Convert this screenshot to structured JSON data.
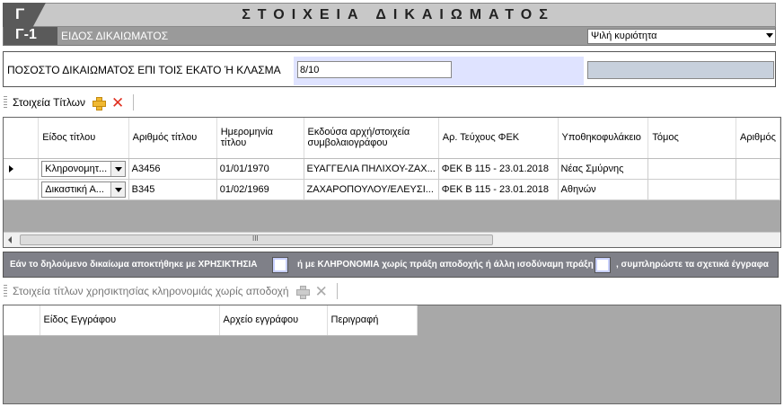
{
  "header": {
    "badge": "Γ",
    "title": "ΣΤΟΙΧΕΙΑ ΔΙΚΑΙΩΜΑΤΟΣ",
    "sub_badge": "Γ-1",
    "sub_label": "ΕΙΔΟΣ ΔΙΚΑΙΩΜΑΤΟΣ",
    "right_type_selected": "Ψιλή κυριότητα"
  },
  "percentage": {
    "label": "ΠΟΣΟΣΤΟ ΔΙΚΑΙΩΜΑΤΟΣ ΕΠΙ ΤΟΙΣ ΕΚΑΤΟ Ή ΚΛΑΣΜΑ",
    "value": "8/10"
  },
  "titles_toolbar": {
    "label": "Στοιχεία Τίτλων"
  },
  "titles_grid": {
    "columns": [
      "Είδος τίτλου",
      "Αριθμός τίτλου",
      "Ημερομηνία τίτλου",
      "Εκδούσα αρχή/στοιχεία συμβολαιογράφου",
      "Αρ. Τεύχους ΦΕΚ",
      "Υποθηκοφυλάκειο",
      "Τόμος",
      "Αριθμός"
    ],
    "rows": [
      {
        "type": "Κληρονομητ...",
        "number": "Α3456",
        "date": "01/01/1970",
        "authority": "ΕΥΑΓΓΕΛΙΑ ΠΗΛΙΧΟΥ-ΖΑΧ...",
        "fek": "ΦΕΚ Β 115 - 23.01.2018",
        "registry": "Νέας Σμύρνης",
        "volume": "",
        "num": ""
      },
      {
        "type": "Δικαστική Α...",
        "number": "Β345",
        "date": "01/02/1969",
        "authority": "ΖΑΧΑΡΟΠΟΥΛΟΥ/ΕΛΕΥΣΙ...",
        "fek": "ΦΕΚ Β 115 - 23.01.2018",
        "registry": "Αθηνών",
        "volume": "",
        "num": ""
      }
    ],
    "scroll_grip": "III"
  },
  "info_bar": {
    "part1": "Εάν το δηλούμενο δικαίωμα  αποκτήθηκε με ΧΡΗΣΙΚΤΗΣΙΑ",
    "part2": "ή με ΚΛΗΡΟΝΟΜΙΑ χωρίς πράξη αποδοχής ή άλλη ισοδύναμη πράξη",
    "part3": ",  συμπληρώστε τα σχετικά έγγραφα"
  },
  "docs_toolbar": {
    "label": "Στοιχεία τίτλων χρησικτησίας κληρονομιάς χωρίς αποδοχή"
  },
  "docs_grid": {
    "columns": [
      "Είδος Εγγράφου",
      "Αρχείο εγγράφου",
      "Περιγραφή"
    ]
  }
}
